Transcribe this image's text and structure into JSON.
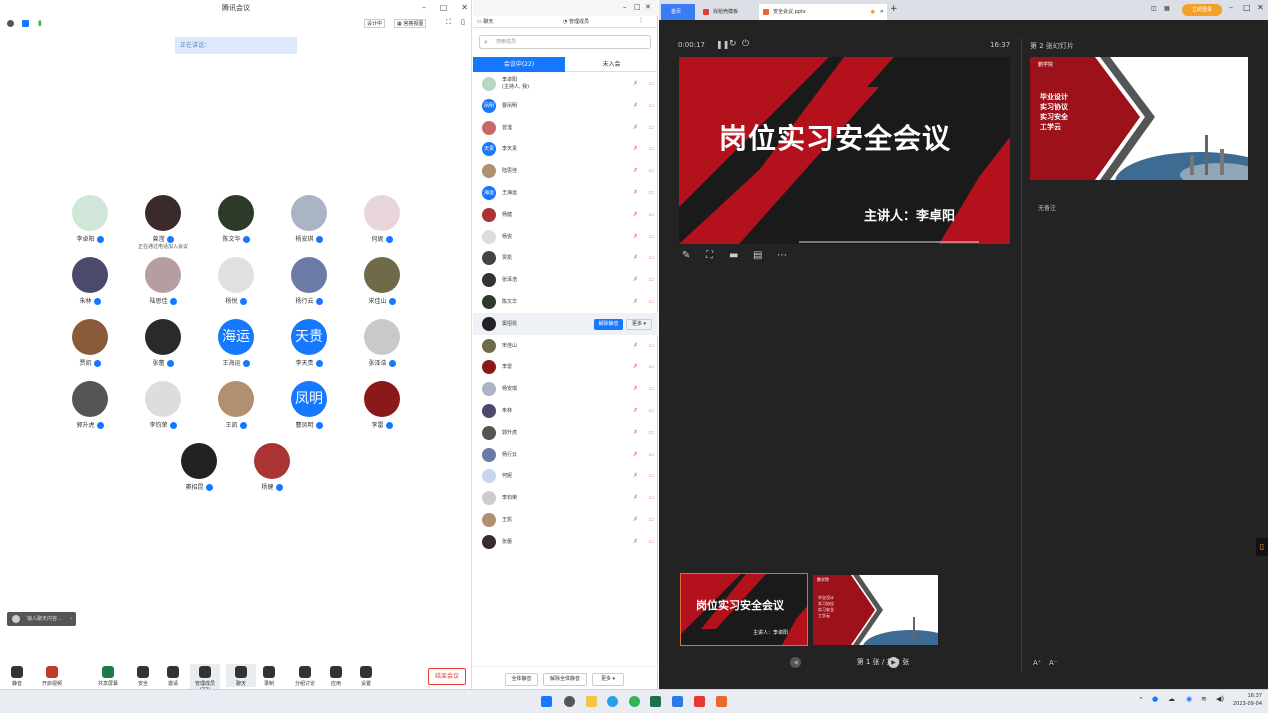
{
  "meeting": {
    "title": "腾讯会议",
    "top_right": {
      "tag1": "设计中",
      "view": "宫格视图"
    },
    "speaking_label": "正在讲话：",
    "typing_label": "输入聊天内容...",
    "participants_grid": [
      {
        "name": "李卓阳",
        "sub": ""
      },
      {
        "name": "曾滢",
        "sub": "正在通过电话加入会议"
      },
      {
        "name": "陈文华",
        "sub": ""
      },
      {
        "name": "杨安琪",
        "sub": ""
      },
      {
        "name": "何妮",
        "sub": ""
      },
      {
        "name": "朱林",
        "sub": ""
      },
      {
        "name": "陆思佳",
        "sub": ""
      },
      {
        "name": "杨悦",
        "sub": ""
      },
      {
        "name": "杨行云",
        "sub": ""
      },
      {
        "name": "宋佳山",
        "sub": ""
      },
      {
        "name": "贾凯",
        "sub": ""
      },
      {
        "name": "张蕾",
        "sub": ""
      },
      {
        "name": "王海运",
        "sub": "",
        "text_avatar": "海运"
      },
      {
        "name": "李天贵",
        "sub": "",
        "text_avatar": "天贵"
      },
      {
        "name": "张泽浩",
        "sub": ""
      },
      {
        "name": "郭升虎",
        "sub": ""
      },
      {
        "name": "李钧荣",
        "sub": ""
      },
      {
        "name": "王凯",
        "sub": ""
      },
      {
        "name": "曹凤明",
        "sub": "",
        "text_avatar": "凤明"
      },
      {
        "name": "李雷",
        "sub": ""
      },
      {
        "name": "窦招昆",
        "sub": ""
      },
      {
        "name": "杨健",
        "sub": ""
      }
    ],
    "toolbar": [
      {
        "label": "静音"
      },
      {
        "label": "开启视频"
      },
      {
        "label": "共享屏幕"
      },
      {
        "label": "安全"
      },
      {
        "label": "邀请"
      },
      {
        "label": "管理成员(22)"
      },
      {
        "label": "聊天"
      },
      {
        "label": "录制"
      },
      {
        "label": "分组讨论"
      },
      {
        "label": "应用"
      },
      {
        "label": "设置"
      }
    ],
    "end_button": "结束会议"
  },
  "panel": {
    "tabs": [
      "聊天",
      "管理成员"
    ],
    "search_placeholder": "搜索成员",
    "segment_in": "会议中(22)",
    "segment_out": "未入会",
    "members": [
      {
        "name": "李卓阳",
        "sub": "(主持人, 我)"
      },
      {
        "name": "曹凤明",
        "avatar_text": "凤明"
      },
      {
        "name": "曾滢"
      },
      {
        "name": "李天贵",
        "avatar_text": "天贵"
      },
      {
        "name": "陆思佳"
      },
      {
        "name": "王海运",
        "avatar_text": "海运"
      },
      {
        "name": "杨健"
      },
      {
        "name": "杨悦"
      },
      {
        "name": "贾凯"
      },
      {
        "name": "张泽浩"
      },
      {
        "name": "陈文华"
      },
      {
        "name": "窦招昆",
        "highlight": true
      },
      {
        "name": "宋佳山"
      },
      {
        "name": "李雷"
      },
      {
        "name": "杨安琪"
      },
      {
        "name": "朱林"
      },
      {
        "name": "郭升虎"
      },
      {
        "name": "杨行云"
      },
      {
        "name": "何妮"
      },
      {
        "name": "李钧荣"
      },
      {
        "name": "王凯"
      },
      {
        "name": "张蕾"
      }
    ],
    "row_actions": {
      "unmute": "解除静音",
      "more": "更多"
    },
    "bottom": {
      "mute_all": "全体静音",
      "unmute_all": "解除全体静音",
      "more": "更多"
    }
  },
  "browser": {
    "tabs": [
      "首页",
      "找稻壳模板",
      "安全会议.pptx"
    ],
    "user_label": "立即登录",
    "timer": "0:00:17",
    "clock": "16:37",
    "slide_indicator": "第 2 张幻灯片",
    "slide_title": "岗位实习安全会议",
    "slide_presenter": "主讲人：李卓阳",
    "next_slide_lines": [
      "毕业设计",
      "实习协议",
      "实习安全",
      "工学云"
    ],
    "next_slide_logo": "鹏学院",
    "notes": "无备注",
    "thumb_title": "岗位实习安全会议",
    "thumb_presenter": "主讲人：李卓阳",
    "pager": "第 1 张 / 共 2 张"
  },
  "taskbar": {
    "time": "16:37",
    "date": "2023-09-04"
  },
  "colors": {
    "accent": "#1677ff",
    "slide_red": "#b3121c",
    "danger": "#e53935"
  }
}
